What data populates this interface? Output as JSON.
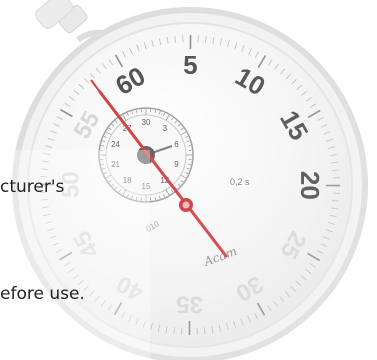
{
  "captions": {
    "line1": "cturer's",
    "line2": "efore use."
  },
  "watch": {
    "main_dial_numbers": [
      "60",
      "5",
      "10",
      "15",
      "20",
      "25",
      "30",
      "35",
      "40",
      "45",
      "50",
      "55"
    ],
    "sub_dial_numbers": [
      "30",
      "3",
      "6",
      "9",
      "12",
      "15",
      "18",
      "21",
      "24",
      "27"
    ],
    "scale_label": "0,2 s",
    "small_label": "010",
    "brand": "Acam"
  },
  "colors": {
    "hand": "#d0383a",
    "numbers": "#4a4a4a",
    "numbers_faint": "#d6d6d6"
  }
}
